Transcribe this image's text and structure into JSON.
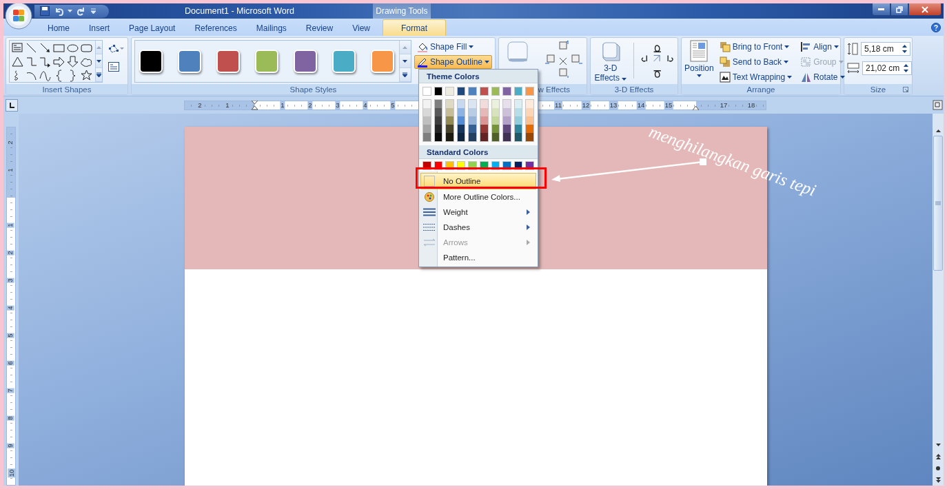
{
  "window": {
    "title": "Document1 - Microsoft Word",
    "context_title": "Drawing Tools"
  },
  "tabs": [
    {
      "label": "Home",
      "selected": false
    },
    {
      "label": "Insert",
      "selected": false
    },
    {
      "label": "Page Layout",
      "selected": false
    },
    {
      "label": "References",
      "selected": false
    },
    {
      "label": "Mailings",
      "selected": false
    },
    {
      "label": "Review",
      "selected": false
    },
    {
      "label": "View",
      "selected": false
    },
    {
      "label": "Format",
      "selected": true
    }
  ],
  "ribbon": {
    "insert_shapes": {
      "label": "Insert Shapes"
    },
    "shape_styles": {
      "label": "Shape Styles",
      "swatches": [
        {
          "color": "#000000"
        },
        {
          "color": "#4f81bd"
        },
        {
          "color": "#c0504d"
        },
        {
          "color": "#9bbb59"
        },
        {
          "color": "#8064a2"
        },
        {
          "color": "#4bacc6"
        },
        {
          "color": "#f79646"
        }
      ],
      "buttons": [
        {
          "label": "Shape Fill",
          "kind": "fill",
          "pressed": false
        },
        {
          "label": "Shape Outline",
          "kind": "outline",
          "pressed": true
        }
      ]
    },
    "shadow_effects": {
      "label": "w Effects"
    },
    "three_d_effects": {
      "label": "3-D Effects",
      "button": "3-D Effects"
    },
    "arrange": {
      "label": "Arrange",
      "position": "Position",
      "buttons": [
        {
          "label": "Bring to Front",
          "kind": "front",
          "disabled": false
        },
        {
          "label": "Send to Back",
          "kind": "back",
          "disabled": false
        },
        {
          "label": "Text Wrapping",
          "kind": "wrap",
          "disabled": false
        },
        {
          "label": "Align",
          "kind": "align",
          "disabled": false
        },
        {
          "label": "Group",
          "kind": "group",
          "disabled": true
        },
        {
          "label": "Rotate",
          "kind": "rotate",
          "disabled": false
        }
      ]
    },
    "size": {
      "label": "Size",
      "height": "5,18 cm",
      "width": "21,02 cm"
    }
  },
  "horizontal_ruler": {
    "labels": [
      "2",
      "1",
      "1",
      "2",
      "3",
      "4",
      "5",
      "11",
      "12",
      "13",
      "14",
      "15",
      "17",
      "18"
    ]
  },
  "vertical_ruler": {
    "labels": [
      "2",
      "1",
      "1",
      "2",
      "3",
      "4",
      "5",
      "6",
      "7",
      "8",
      "9",
      "10"
    ]
  },
  "outline_menu": {
    "theme_header": "Theme Colors",
    "theme_colors": [
      {
        "color": "#ffffff",
        "shades": [
          {
            "color": "#f2f2f2"
          },
          {
            "color": "#d8d8d8"
          },
          {
            "color": "#bfbfbf"
          },
          {
            "color": "#a5a5a5"
          },
          {
            "color": "#7f7f7f"
          }
        ]
      },
      {
        "color": "#000000",
        "shades": [
          {
            "color": "#7f7f7f"
          },
          {
            "color": "#595959"
          },
          {
            "color": "#3f3f3f"
          },
          {
            "color": "#262626"
          },
          {
            "color": "#0c0c0c"
          }
        ]
      },
      {
        "color": "#eeece1",
        "shades": [
          {
            "color": "#ddd9c3"
          },
          {
            "color": "#c4bd97"
          },
          {
            "color": "#938953"
          },
          {
            "color": "#494429"
          },
          {
            "color": "#1d1b10"
          }
        ]
      },
      {
        "color": "#1f497d",
        "shades": [
          {
            "color": "#c6d9f0"
          },
          {
            "color": "#8db3e2"
          },
          {
            "color": "#548dd4"
          },
          {
            "color": "#17365d"
          },
          {
            "color": "#0f243e"
          }
        ]
      },
      {
        "color": "#4f81bd",
        "shades": [
          {
            "color": "#dbe5f1"
          },
          {
            "color": "#b8cce4"
          },
          {
            "color": "#95b3d7"
          },
          {
            "color": "#366092"
          },
          {
            "color": "#244061"
          }
        ]
      },
      {
        "color": "#c0504d",
        "shades": [
          {
            "color": "#f2dcdb"
          },
          {
            "color": "#e5b9b7"
          },
          {
            "color": "#d99694"
          },
          {
            "color": "#953734"
          },
          {
            "color": "#632423"
          }
        ]
      },
      {
        "color": "#9bbb59",
        "shades": [
          {
            "color": "#ebf1dd"
          },
          {
            "color": "#d7e3bc"
          },
          {
            "color": "#c3d69b"
          },
          {
            "color": "#76923c"
          },
          {
            "color": "#4f6128"
          }
        ]
      },
      {
        "color": "#8064a2",
        "shades": [
          {
            "color": "#e5e0ec"
          },
          {
            "color": "#ccc1d9"
          },
          {
            "color": "#b2a2c7"
          },
          {
            "color": "#5f497a"
          },
          {
            "color": "#3f3151"
          }
        ]
      },
      {
        "color": "#4bacc6",
        "shades": [
          {
            "color": "#dbeef3"
          },
          {
            "color": "#b7dde8"
          },
          {
            "color": "#92cddc"
          },
          {
            "color": "#31859b"
          },
          {
            "color": "#205867"
          }
        ]
      },
      {
        "color": "#f79646",
        "shades": [
          {
            "color": "#fdeada"
          },
          {
            "color": "#fbd5b5"
          },
          {
            "color": "#fac08f"
          },
          {
            "color": "#e36c09"
          },
          {
            "color": "#974806"
          }
        ]
      }
    ],
    "standard_header": "Standard Colors",
    "standard_colors": [
      {
        "color": "#c00000"
      },
      {
        "color": "#ff0000"
      },
      {
        "color": "#ffc000"
      },
      {
        "color": "#ffff00"
      },
      {
        "color": "#92d050"
      },
      {
        "color": "#00b050"
      },
      {
        "color": "#00b0f0"
      },
      {
        "color": "#0070c0"
      },
      {
        "color": "#002060"
      },
      {
        "color": "#7030a0"
      }
    ],
    "items": [
      {
        "label": "No Outline",
        "kind": "none",
        "highlighted": true,
        "disabled": false,
        "submenu": false
      },
      {
        "label": "More Outline Colors...",
        "kind": "palette",
        "highlighted": false,
        "disabled": false,
        "submenu": false
      },
      {
        "label": "Weight",
        "kind": "weight",
        "highlighted": false,
        "disabled": false,
        "submenu": true
      },
      {
        "label": "Dashes",
        "kind": "dashes",
        "highlighted": false,
        "disabled": false,
        "submenu": true
      },
      {
        "label": "Arrows",
        "kind": "arrows",
        "highlighted": false,
        "disabled": true,
        "submenu": true
      },
      {
        "label": "Pattern...",
        "kind": "plain",
        "highlighted": false,
        "disabled": false,
        "submenu": false
      }
    ]
  },
  "annotation": {
    "text": "menghilangkan garis tepi"
  }
}
